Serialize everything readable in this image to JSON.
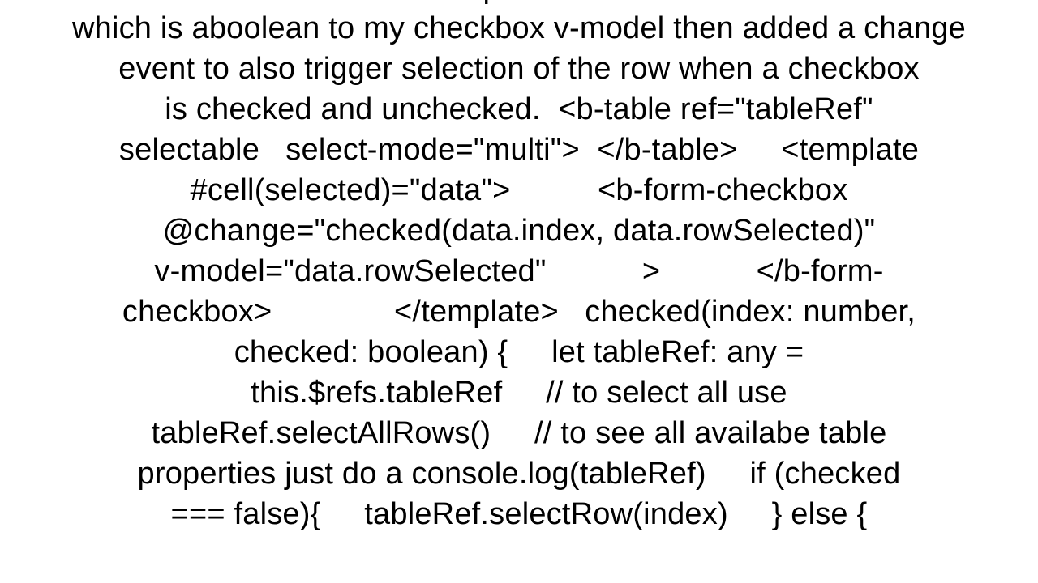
{
  "document": {
    "body_text": "cell slot. i added a cell scoped slot then used rowSelected\nwhich is aboolean to my checkbox v-model then added a change\nevent to also trigger selection of the row when a checkbox\nis checked and unchecked.  <b-table ref=\"tableRef\"\nselectable   select-mode=\"multi\">  </b-table>     <template\n#cell(selected)=\"data\">          <b-form-checkbox\n@change=\"checked(data.index, data.rowSelected)\"\nv-model=\"data.rowSelected\"           >           </b-form-\ncheckbox>              </template>   checked(index: number,\nchecked: boolean) {     let tableRef: any =\nthis.$refs.tableRef     // to select all use\ntableRef.selectAllRows()     // to see all availabe table\nproperties just do a console.log(tableRef)     if (checked\n=== false){     tableRef.selectRow(index)     } else {"
  }
}
